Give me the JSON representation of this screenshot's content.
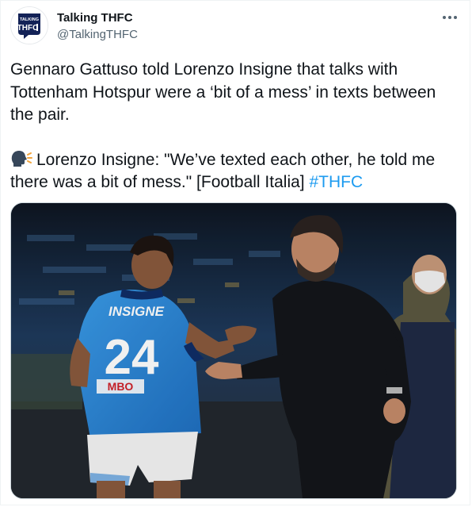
{
  "author": {
    "display_name": "Talking THFC",
    "handle": "@TalkingTHFC",
    "avatar_text": "TALKING THFC"
  },
  "tweet": {
    "paragraph_1": "Gennaro Gattuso told Lorenzo Insigne that talks with Tottenham Hotspur were a ‘bit of a mess’ in texts between the pair.",
    "paragraph_2": "Lorenzo Insigne: \"We’ve texted each other, he told me there was a bit of mess.\" [Football Italia] ",
    "hashtag": "#THFC",
    "emoji": "speaking-head-icon"
  },
  "media": {
    "jersey_name": "INSIGNE",
    "jersey_number": "24",
    "sponsor": "MBO"
  },
  "colors": {
    "link": "#1d9bf0",
    "text": "#0f1419",
    "secondary": "#536471",
    "jersey": "#2e86d9"
  }
}
